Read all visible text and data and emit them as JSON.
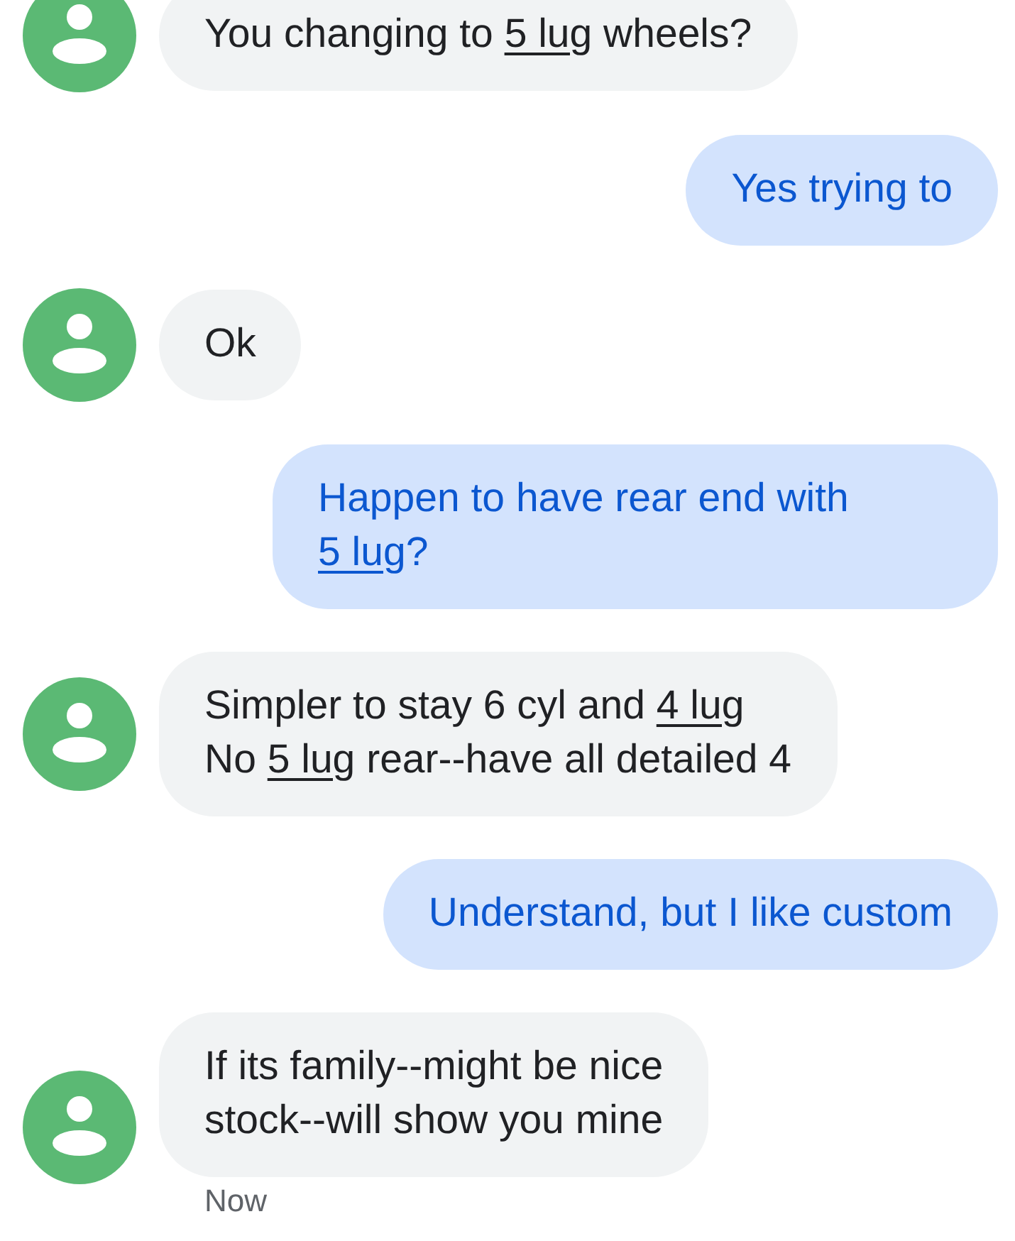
{
  "messages": [
    {
      "kind": "incoming",
      "parts": [
        {
          "text": "You changing to ",
          "underlined": false
        },
        {
          "text": "5 lug",
          "underlined": true
        },
        {
          "text": " wheels?",
          "underlined": false
        }
      ]
    },
    {
      "kind": "outgoing",
      "parts": [
        {
          "text": "Yes trying to",
          "underlined": false
        }
      ]
    },
    {
      "kind": "incoming",
      "parts": [
        {
          "text": "Ok",
          "underlined": false
        }
      ]
    },
    {
      "kind": "outgoing",
      "parts": [
        {
          "text": "Happen to have rear end with ",
          "underlined": false
        },
        {
          "text": "5 lug",
          "underlined": true
        },
        {
          "text": "?",
          "underlined": false
        }
      ]
    },
    {
      "kind": "incoming",
      "parts": [
        {
          "text": "Simpler to stay 6 cyl and ",
          "underlined": false
        },
        {
          "text": "4 lug",
          "underlined": true
        },
        {
          "text": "\nNo ",
          "underlined": false
        },
        {
          "text": "5 lug",
          "underlined": true
        },
        {
          "text": " rear--have all detailed 4",
          "underlined": false
        }
      ]
    },
    {
      "kind": "outgoing",
      "parts": [
        {
          "text": "Understand, but I like custom",
          "underlined": false
        }
      ]
    },
    {
      "kind": "incoming",
      "parts": [
        {
          "text": "If its family--might be nice\nstock--will show you mine",
          "underlined": false
        }
      ],
      "timestamp": "Now"
    }
  ]
}
